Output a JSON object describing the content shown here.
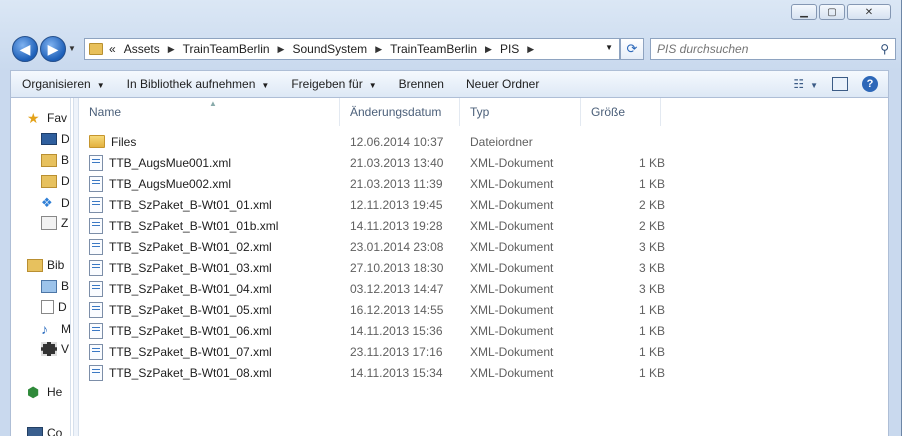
{
  "window": {
    "caption": {
      "minimize": "▁",
      "maximize": "▢",
      "close": "✕"
    }
  },
  "nav": {
    "back_glyph": "◀",
    "forward_glyph": "▶",
    "breadcrumb_prefix": "«",
    "breadcrumbs": [
      "Assets",
      "TrainTeamBerlin",
      "SoundSystem",
      "TrainTeamBerlin",
      "PIS"
    ],
    "search_placeholder": "PIS durchsuchen"
  },
  "toolbar": {
    "organize": "Organisieren",
    "library": "In Bibliothek aufnehmen",
    "share": "Freigeben für",
    "burn": "Brennen",
    "new_folder": "Neuer Ordner",
    "help": "?"
  },
  "navpane": {
    "favorites": "Fav",
    "fav_items": [
      "D",
      "B",
      "D",
      "D",
      "Z"
    ],
    "libraries": "Bib",
    "lib_items": [
      "B",
      "D",
      "M",
      "V"
    ],
    "homegroup": "He",
    "computer": "Co"
  },
  "columns": {
    "name": "Name",
    "date": "Änderungsdatum",
    "type": "Typ",
    "size": "Größe"
  },
  "files": [
    {
      "name": "Files",
      "date": "12.06.2014 10:37",
      "type": "Dateiordner",
      "size": "",
      "icon": "folder-icon"
    },
    {
      "name": "TTB_AugsMue001.xml",
      "date": "21.03.2013 13:40",
      "type": "XML-Dokument",
      "size": "1 KB",
      "icon": "xml-file-icon"
    },
    {
      "name": "TTB_AugsMue002.xml",
      "date": "21.03.2013 11:39",
      "type": "XML-Dokument",
      "size": "1 KB",
      "icon": "xml-file-icon"
    },
    {
      "name": "TTB_SzPaket_B-Wt01_01.xml",
      "date": "12.11.2013 19:45",
      "type": "XML-Dokument",
      "size": "2 KB",
      "icon": "xml-file-icon"
    },
    {
      "name": "TTB_SzPaket_B-Wt01_01b.xml",
      "date": "14.11.2013 19:28",
      "type": "XML-Dokument",
      "size": "2 KB",
      "icon": "xml-file-icon"
    },
    {
      "name": "TTB_SzPaket_B-Wt01_02.xml",
      "date": "23.01.2014 23:08",
      "type": "XML-Dokument",
      "size": "3 KB",
      "icon": "xml-file-icon"
    },
    {
      "name": "TTB_SzPaket_B-Wt01_03.xml",
      "date": "27.10.2013 18:30",
      "type": "XML-Dokument",
      "size": "3 KB",
      "icon": "xml-file-icon"
    },
    {
      "name": "TTB_SzPaket_B-Wt01_04.xml",
      "date": "03.12.2013 14:47",
      "type": "XML-Dokument",
      "size": "3 KB",
      "icon": "xml-file-icon"
    },
    {
      "name": "TTB_SzPaket_B-Wt01_05.xml",
      "date": "16.12.2013 14:55",
      "type": "XML-Dokument",
      "size": "1 KB",
      "icon": "xml-file-icon"
    },
    {
      "name": "TTB_SzPaket_B-Wt01_06.xml",
      "date": "14.11.2013 15:36",
      "type": "XML-Dokument",
      "size": "1 KB",
      "icon": "xml-file-icon"
    },
    {
      "name": "TTB_SzPaket_B-Wt01_07.xml",
      "date": "23.11.2013 17:16",
      "type": "XML-Dokument",
      "size": "1 KB",
      "icon": "xml-file-icon"
    },
    {
      "name": "TTB_SzPaket_B-Wt01_08.xml",
      "date": "14.11.2013 15:34",
      "type": "XML-Dokument",
      "size": "1 KB",
      "icon": "xml-file-icon"
    }
  ]
}
